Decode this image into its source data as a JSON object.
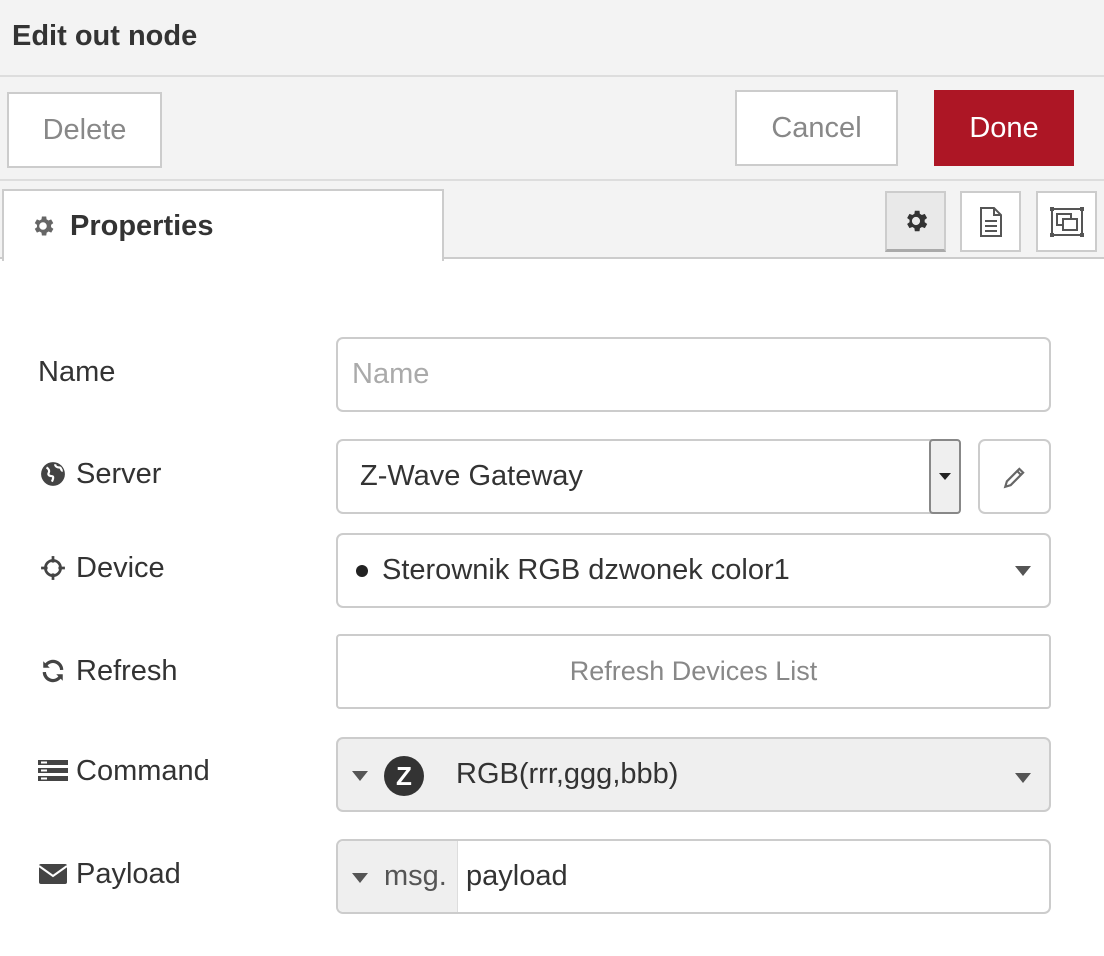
{
  "dialog": {
    "title": "Edit out node"
  },
  "toolbar": {
    "delete_label": "Delete",
    "cancel_label": "Cancel",
    "done_label": "Done"
  },
  "tabs": {
    "properties_label": "Properties",
    "icons": [
      "gear-icon",
      "document-icon",
      "frame-icon"
    ]
  },
  "form": {
    "name": {
      "label": "Name",
      "placeholder": "Name",
      "value": ""
    },
    "server": {
      "label": "Server",
      "value": "Z-Wave Gateway"
    },
    "device": {
      "label": "Device",
      "value": "Sterownik RGB dzwonek color1"
    },
    "refresh": {
      "label": "Refresh",
      "button_label": "Refresh Devices List"
    },
    "command": {
      "label": "Command",
      "badge": "Z",
      "value": "RGB(rrr,ggg,bbb)"
    },
    "payload": {
      "label": "Payload",
      "type_label": "msg.",
      "value": "payload"
    }
  },
  "colors": {
    "done": "#ad1625",
    "panel_bg": "#f3f3f3",
    "border": "#cccccc"
  }
}
